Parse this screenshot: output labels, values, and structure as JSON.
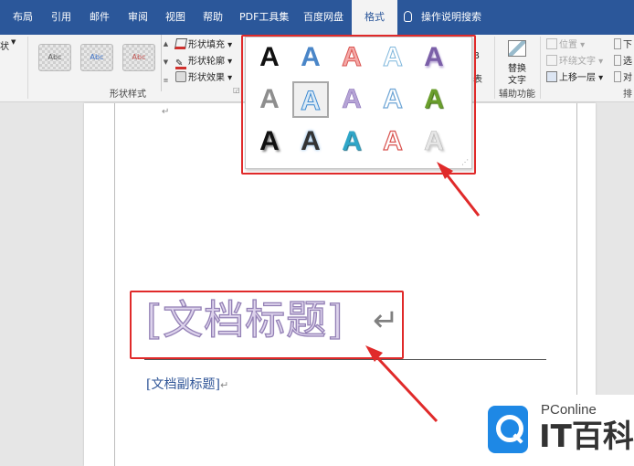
{
  "tabs": [
    "布局",
    "引用",
    "邮件",
    "审阅",
    "视图",
    "帮助",
    "PDF工具集",
    "百度网盘",
    "格式"
  ],
  "tell_me": "操作说明搜索",
  "ribbon": {
    "left_cut": "状",
    "shape_style_thumb": "Abc",
    "shape_fill": "形状填充",
    "shape_outline": "形状轮廓",
    "shape_effects": "形状效果",
    "shape_styles_group": "形状样式",
    "alt_text_line1": "替换",
    "alt_text_line2": "文字",
    "accessibility_group": "辅助功能",
    "position": "位置",
    "wrap_text": "环绕文字",
    "bring_forward": "上移一层",
    "right_cut_1": "下",
    "right_cut_2": "选",
    "right_cut_3": "对",
    "arrange_cut": "排",
    "hidden_cut_1": "B",
    "hidden_cut_2": "表"
  },
  "wordart_gallery": {
    "glyph": "A",
    "styles": [
      "black-solid",
      "blue-gradient",
      "red-outline-fill",
      "light-blue-outline",
      "purple-shadow",
      "gray-solid",
      "blue-outline-selected",
      "lavender-fill",
      "blue-outline",
      "green-gradient",
      "black-shadow",
      "dark-gray-glow",
      "teal-gradient",
      "red-outline",
      "pale-gray"
    ],
    "selected_index": 6
  },
  "document": {
    "title": "[文档标题]",
    "subtitle": "[文档副标题]",
    "paragraph_mark": "↵"
  },
  "watermark": {
    "line1": "PConline",
    "line2": "IT百科"
  },
  "colors": {
    "tab_bar": "#2b579a",
    "ribbon": "#f3f3f3",
    "highlight": "#e02a2a",
    "title_fill": "#ddd3ec",
    "title_outline": "#9380b5",
    "subtitle": "#2f5597"
  }
}
